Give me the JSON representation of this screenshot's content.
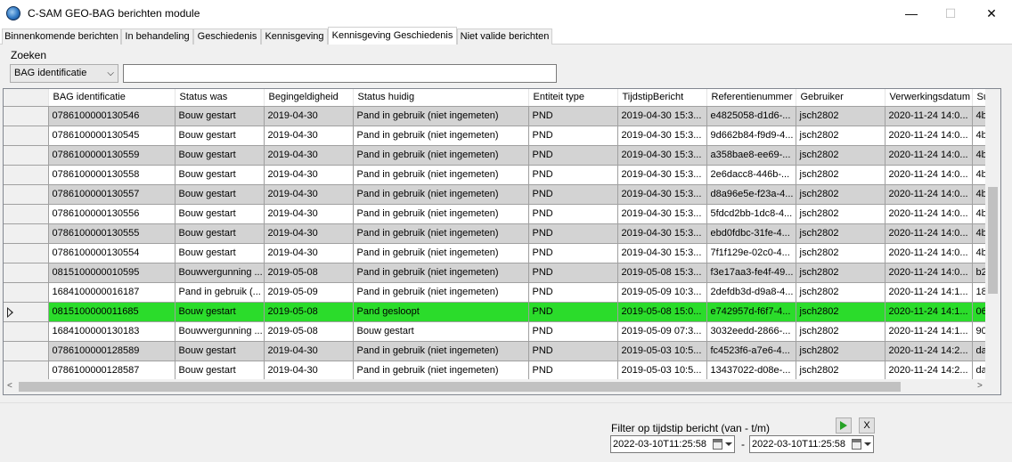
{
  "window": {
    "title": "C-SAM GEO-BAG berichten module",
    "minimize": "—",
    "maximize": "☐",
    "close": "✕"
  },
  "tabs": [
    {
      "label": "Binnenkomende berichten"
    },
    {
      "label": "In behandeling"
    },
    {
      "label": "Geschiedenis"
    },
    {
      "label": "Kennisgeving"
    },
    {
      "label": "Kennisgeving Geschiedenis",
      "active": true
    },
    {
      "label": "Niet valide berichten"
    }
  ],
  "search": {
    "label": "Zoeken",
    "field_selected": "BAG identificatie",
    "value": ""
  },
  "grid": {
    "columns": [
      "BAG identificatie",
      "Status was",
      "Begingeldigheid",
      "Status huidig",
      "Entiteit type",
      "TijdstipBericht",
      "Referentienummer",
      "Gebruiker",
      "Verwerkingsdatum",
      "Su"
    ],
    "rows": [
      [
        "0786100000130546",
        "Bouw gestart",
        "2019-04-30",
        "Pand in gebruik (niet ingemeten)",
        "PND",
        "2019-04-30 15:3...",
        "e4825058-d1d6-...",
        "jsch2802",
        "2020-11-24 14:0...",
        "4b"
      ],
      [
        "0786100000130545",
        "Bouw gestart",
        "2019-04-30",
        "Pand in gebruik (niet ingemeten)",
        "PND",
        "2019-04-30 15:3...",
        "9d662b84-f9d9-4...",
        "jsch2802",
        "2020-11-24 14:0...",
        "4b"
      ],
      [
        "0786100000130559",
        "Bouw gestart",
        "2019-04-30",
        "Pand in gebruik (niet ingemeten)",
        "PND",
        "2019-04-30 15:3...",
        "a358bae8-ee69-...",
        "jsch2802",
        "2020-11-24 14:0...",
        "4b"
      ],
      [
        "0786100000130558",
        "Bouw gestart",
        "2019-04-30",
        "Pand in gebruik (niet ingemeten)",
        "PND",
        "2019-04-30 15:3...",
        "2e6dacc8-446b-...",
        "jsch2802",
        "2020-11-24 14:0...",
        "4b"
      ],
      [
        "0786100000130557",
        "Bouw gestart",
        "2019-04-30",
        "Pand in gebruik (niet ingemeten)",
        "PND",
        "2019-04-30 15:3...",
        "d8a96e5e-f23a-4...",
        "jsch2802",
        "2020-11-24 14:0...",
        "4b"
      ],
      [
        "0786100000130556",
        "Bouw gestart",
        "2019-04-30",
        "Pand in gebruik (niet ingemeten)",
        "PND",
        "2019-04-30 15:3...",
        "5fdcd2bb-1dc8-4...",
        "jsch2802",
        "2020-11-24 14:0...",
        "4b"
      ],
      [
        "0786100000130555",
        "Bouw gestart",
        "2019-04-30",
        "Pand in gebruik (niet ingemeten)",
        "PND",
        "2019-04-30 15:3...",
        "ebd0fdbc-31fe-4...",
        "jsch2802",
        "2020-11-24 14:0...",
        "4b"
      ],
      [
        "0786100000130554",
        "Bouw gestart",
        "2019-04-30",
        "Pand in gebruik (niet ingemeten)",
        "PND",
        "2019-04-30 15:3...",
        "7f1f129e-02c0-4...",
        "jsch2802",
        "2020-11-24 14:0...",
        "4b"
      ],
      [
        "0815100000010595",
        "Bouwvergunning ...",
        "2019-05-08",
        "Pand in gebruik (niet ingemeten)",
        "PND",
        "2019-05-08 15:3...",
        "f3e17aa3-fe4f-49...",
        "jsch2802",
        "2020-11-24 14:0...",
        "b2"
      ],
      [
        "1684100000016187",
        "Pand in gebruik (...",
        "2019-05-09",
        "Pand in gebruik (niet ingemeten)",
        "PND",
        "2019-05-09 10:3...",
        "2defdb3d-d9a8-4...",
        "jsch2802",
        "2020-11-24 14:1...",
        "18"
      ],
      [
        "0815100000011685",
        "Bouw gestart",
        "2019-05-08",
        "Pand gesloopt",
        "PND",
        "2019-05-08 15:0...",
        "e742957d-f6f7-4...",
        "jsch2802",
        "2020-11-24 14:1...",
        "06"
      ],
      [
        "1684100000130183",
        "Bouwvergunning ...",
        "2019-05-08",
        "Bouw gestart",
        "PND",
        "2019-05-09 07:3...",
        "3032eedd-2866-...",
        "jsch2802",
        "2020-11-24 14:1...",
        "90"
      ],
      [
        "0786100000128589",
        "Bouw gestart",
        "2019-04-30",
        "Pand in gebruik (niet ingemeten)",
        "PND",
        "2019-05-03 10:5...",
        "fc4523f6-a7e6-4...",
        "jsch2802",
        "2020-11-24 14:2...",
        "da"
      ],
      [
        "0786100000128587",
        "Bouw gestart",
        "2019-04-30",
        "Pand in gebruik (niet ingemeten)",
        "PND",
        "2019-05-03 10:5...",
        "13437022-d08e-...",
        "jsch2802",
        "2020-11-24 14:2...",
        "da"
      ]
    ],
    "selected_row": 10,
    "selected_color": "#2bdc2b"
  },
  "filter": {
    "label": "Filter op tijdstip bericht (van - t/m)",
    "from": "2022-03-10T11:25:58",
    "to": "2022-03-10T11:25:58",
    "separator": "-",
    "apply_icon": "play-icon",
    "clear_label": "X"
  }
}
